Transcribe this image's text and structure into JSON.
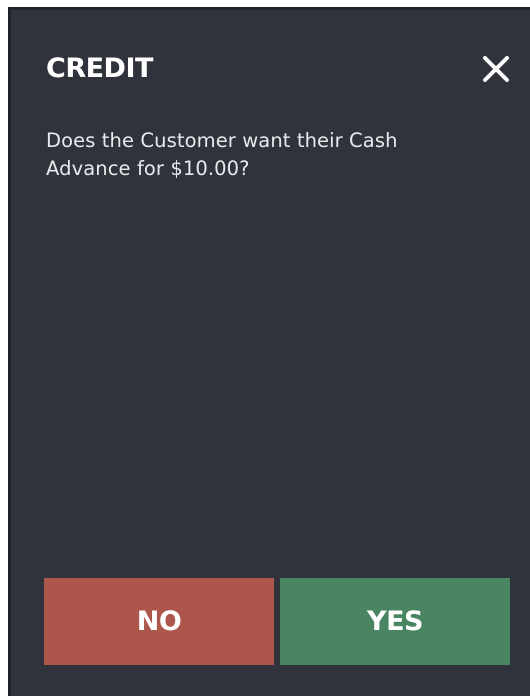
{
  "dialog": {
    "title": "CREDIT",
    "message": "Does the Customer want their Cash Advance for $10.00?",
    "close_icon": "close-icon",
    "buttons": {
      "no_label": "NO",
      "yes_label": "YES"
    }
  },
  "colors": {
    "dialog_background": "#30333b",
    "no_button": "#ad564c",
    "yes_button": "#4a8561",
    "text": "#ffffff"
  }
}
